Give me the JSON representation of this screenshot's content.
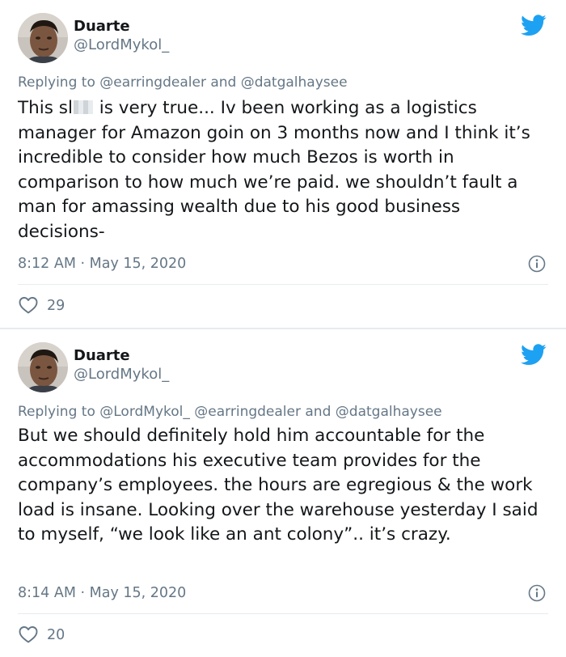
{
  "colors": {
    "background": "#e6ecf0",
    "card": "#ffffff",
    "text": "#14171a",
    "secondary": "#657786",
    "twitter_blue": "#1da1f2"
  },
  "tweets": [
    {
      "author": {
        "name": "Duarte",
        "handle": "@LordMykol_"
      },
      "brand_icon": "twitter-bird-icon",
      "reply_prefix": "Replying to ",
      "reply_mentions": "@earringdealer and @datgalhaysee",
      "text_before_censor": "This sl",
      "text_after_censor": " is very true... Iv been working as a logistics manager for Amazon goin on 3 months now and I think it’s incredible to consider how much Bezos is worth in comparison to how much we’re paid. we shouldn’t fault a man for amassing wealth due to his good business decisions-",
      "time": "8:12 AM",
      "separator": " · ",
      "date": "May 15, 2020",
      "likes": "29"
    },
    {
      "author": {
        "name": "Duarte",
        "handle": "@LordMykol_"
      },
      "brand_icon": "twitter-bird-icon",
      "reply_prefix": "Replying to ",
      "reply_mentions": "@LordMykol_ @earringdealer and @datgalhaysee",
      "text": "But we should definitely hold him accountable for the accommodations his executive team provides for the company’s employees. the hours are egregious & the work load is insane. Looking over the warehouse yesterday I said to myself, “we look like an ant colony”.. it’s crazy.",
      "time": "8:14 AM",
      "separator": " · ",
      "date": "May 15, 2020",
      "likes": "20"
    }
  ]
}
